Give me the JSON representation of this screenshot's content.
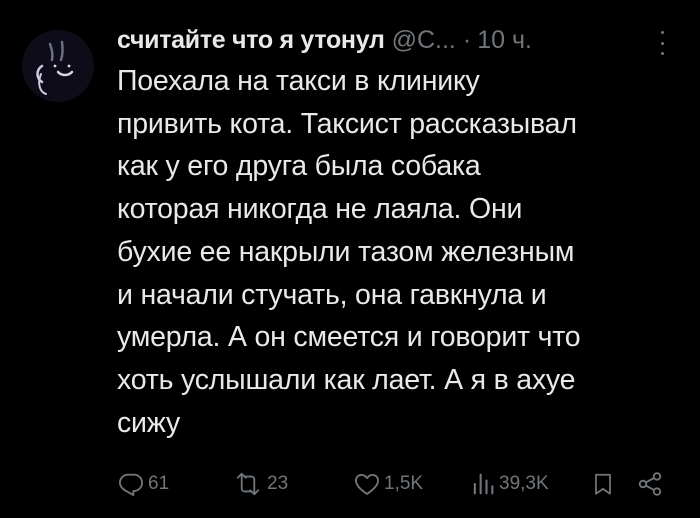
{
  "tweet": {
    "author_name": "считайте что я утонул",
    "handle": "@С...",
    "separator": "·",
    "time": "10 ч.",
    "lines": [
      "Поехала на такси в клинику",
      "привить кота. Таксист рассказывал",
      "как у его друга была собака",
      "которая никогда не лаяла. Они",
      "бухие ее накрыли тазом железным",
      "и начали стучать, она гавкнула и",
      "умерла. А он смеется и говорит что",
      "хоть услышали как лает. А я в ахуе",
      "сижу"
    ]
  },
  "actions": {
    "reply_count": "61",
    "retweet_count": "23",
    "like_count": "1,5K",
    "views_count": "39,3K"
  },
  "icons": {
    "reply": "reply-icon",
    "retweet": "retweet-icon",
    "like": "heart-icon",
    "views": "bar-chart-icon",
    "bookmark": "bookmark-icon",
    "share": "share-icon",
    "more": "more-options-icon"
  },
  "colors": {
    "background": "#000000",
    "text": "#e7e9ea",
    "secondary": "#71767b"
  }
}
